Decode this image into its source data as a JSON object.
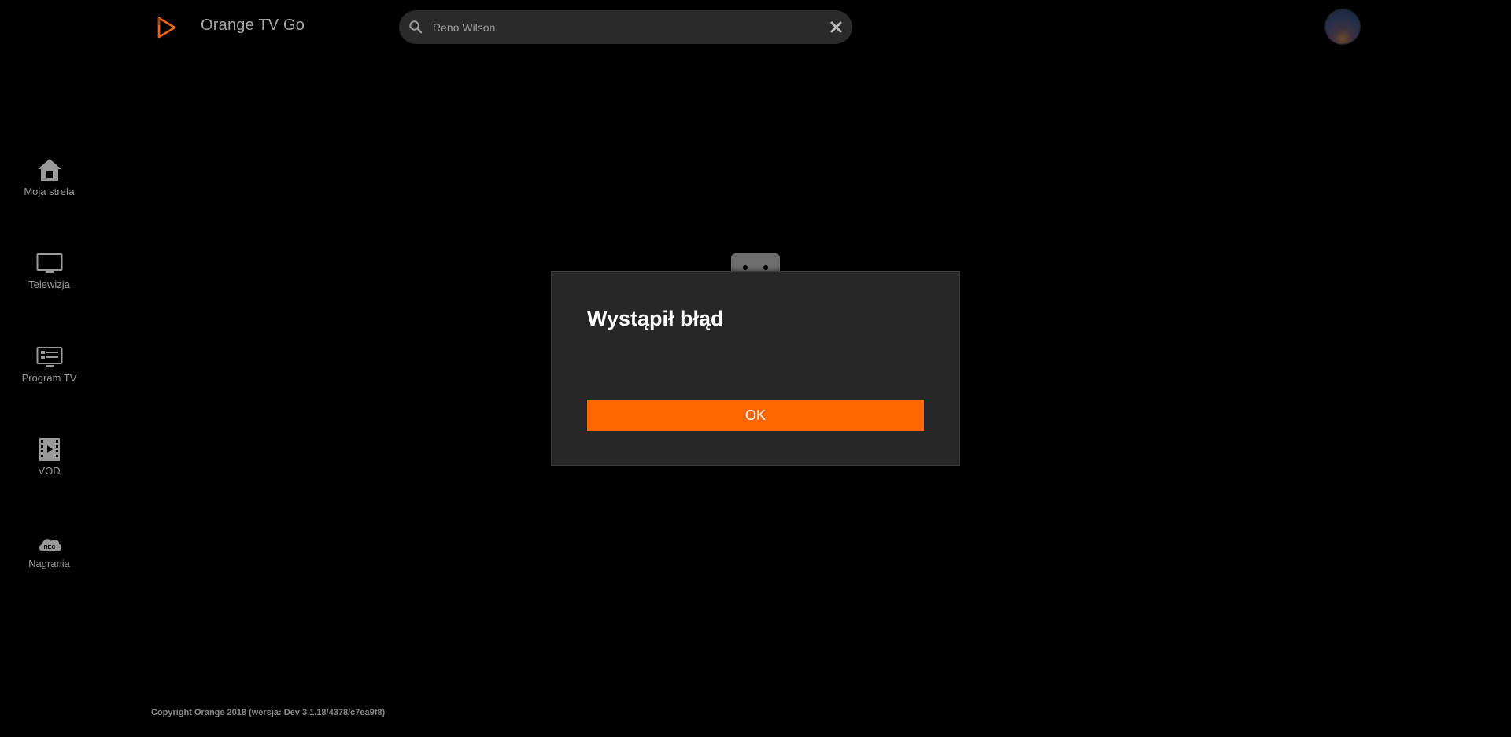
{
  "header": {
    "app_title": "Orange TV Go",
    "search": {
      "value": "Reno Wilson",
      "icon": "search-icon"
    },
    "clear_icon": "close-icon",
    "avatar_icon": "user-avatar"
  },
  "sidebar": {
    "items": [
      {
        "label": "Moja strefa",
        "icon": "home-icon"
      },
      {
        "label": "Telewizja",
        "icon": "tv-icon"
      },
      {
        "label": "Program TV",
        "icon": "tv-guide-icon"
      },
      {
        "label": "VOD",
        "icon": "film-icon"
      },
      {
        "label": "Nagrania",
        "icon": "rec-cloud-icon"
      }
    ]
  },
  "modal": {
    "title": "Wystąpił błąd",
    "ok_label": "OK"
  },
  "footer": {
    "copyright": "Copyright Orange 2018 (wersja: Dev 3.1.18/4378/c7ea9f8)"
  },
  "colors": {
    "background": "#000000",
    "accent": "#ff6600",
    "modal_bg": "#272727",
    "text_muted": "#9a9a9a"
  }
}
